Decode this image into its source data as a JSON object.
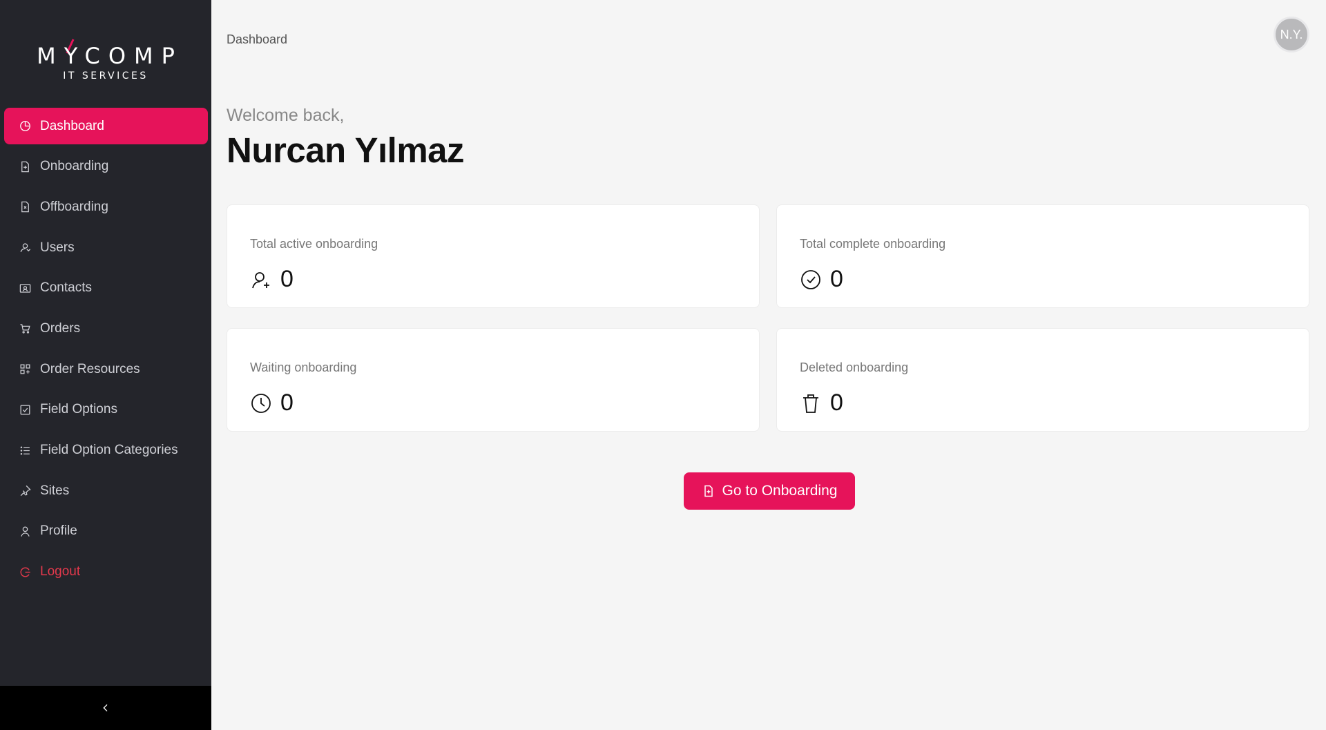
{
  "brand": {
    "logo_main": "MYCOMP",
    "logo_sub": "IT SERVICES",
    "accent_color": "#e6135a"
  },
  "sidebar": {
    "items": [
      {
        "label": "Dashboard",
        "icon": "pie-chart-icon",
        "active": true
      },
      {
        "label": "Onboarding",
        "icon": "file-plus-icon"
      },
      {
        "label": "Offboarding",
        "icon": "file-x-icon"
      },
      {
        "label": "Users",
        "icon": "users-icon"
      },
      {
        "label": "Contacts",
        "icon": "contact-card-icon"
      },
      {
        "label": "Orders",
        "icon": "cart-icon"
      },
      {
        "label": "Order Resources",
        "icon": "grid-icon"
      },
      {
        "label": "Field Options",
        "icon": "checkbox-icon"
      },
      {
        "label": "Field Option Categories",
        "icon": "list-icon"
      },
      {
        "label": "Sites",
        "icon": "pin-icon"
      },
      {
        "label": "Profile",
        "icon": "user-icon"
      },
      {
        "label": "Logout",
        "icon": "logout-icon",
        "color": "#e5394c"
      }
    ],
    "collapse_icon": "chevron-left-icon"
  },
  "header": {
    "breadcrumb": "Dashboard",
    "avatar_initials": "N.Y."
  },
  "main": {
    "welcome": "Welcome back,",
    "user_name": "Nurcan Yılmaz",
    "stats": [
      {
        "title": "Total active onboarding",
        "value": "0",
        "icon": "user-add-icon"
      },
      {
        "title": "Total complete onboarding",
        "value": "0",
        "icon": "check-circle-icon"
      },
      {
        "title": "Waiting onboarding",
        "value": "0",
        "icon": "clock-icon"
      },
      {
        "title": "Deleted onboarding",
        "value": "0",
        "icon": "trash-icon"
      }
    ],
    "cta_label": "Go to Onboarding",
    "cta_icon": "file-plus-icon"
  }
}
